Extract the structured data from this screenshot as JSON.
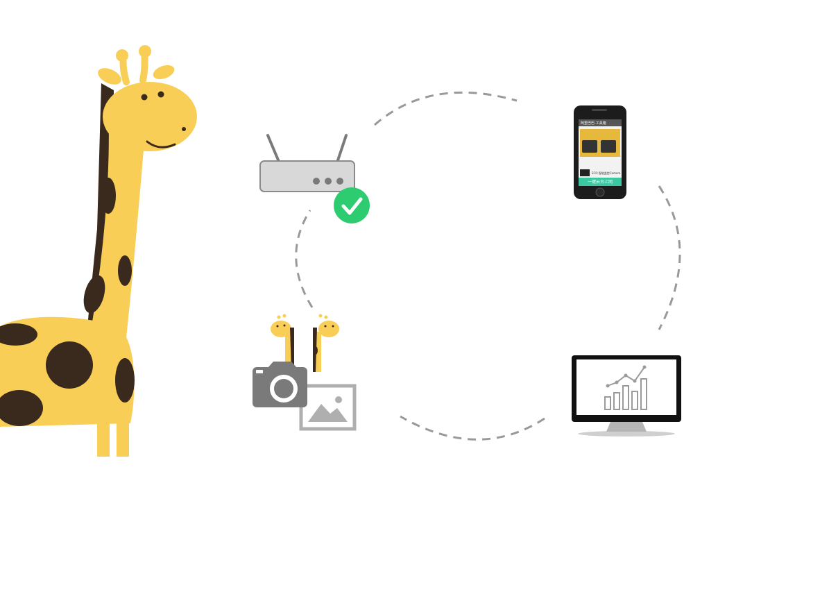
{
  "diagram": {
    "nodes": [
      {
        "id": "router",
        "icon": "router-icon",
        "status": "connected"
      },
      {
        "id": "phone",
        "icon": "smartphone-icon"
      },
      {
        "id": "monitor",
        "icon": "monitor-chart-icon"
      },
      {
        "id": "camera",
        "icon": "camera-image-icon"
      }
    ],
    "connectors": [
      "router-phone",
      "phone-monitor",
      "monitor-camera",
      "camera-router"
    ]
  },
  "phone_screen": {
    "title": "阿里巴巴-工具箱",
    "caption": "ECO 智能监控Camera",
    "button": "一键云台上网"
  },
  "colors": {
    "giraffe_yellow": "#F9CE57",
    "giraffe_spot": "#3A2A1E",
    "check_green": "#2ECC71",
    "icon_gray": "#7A7A7A",
    "accent_teal": "#3CC7A0",
    "connector_gray": "#999999"
  }
}
